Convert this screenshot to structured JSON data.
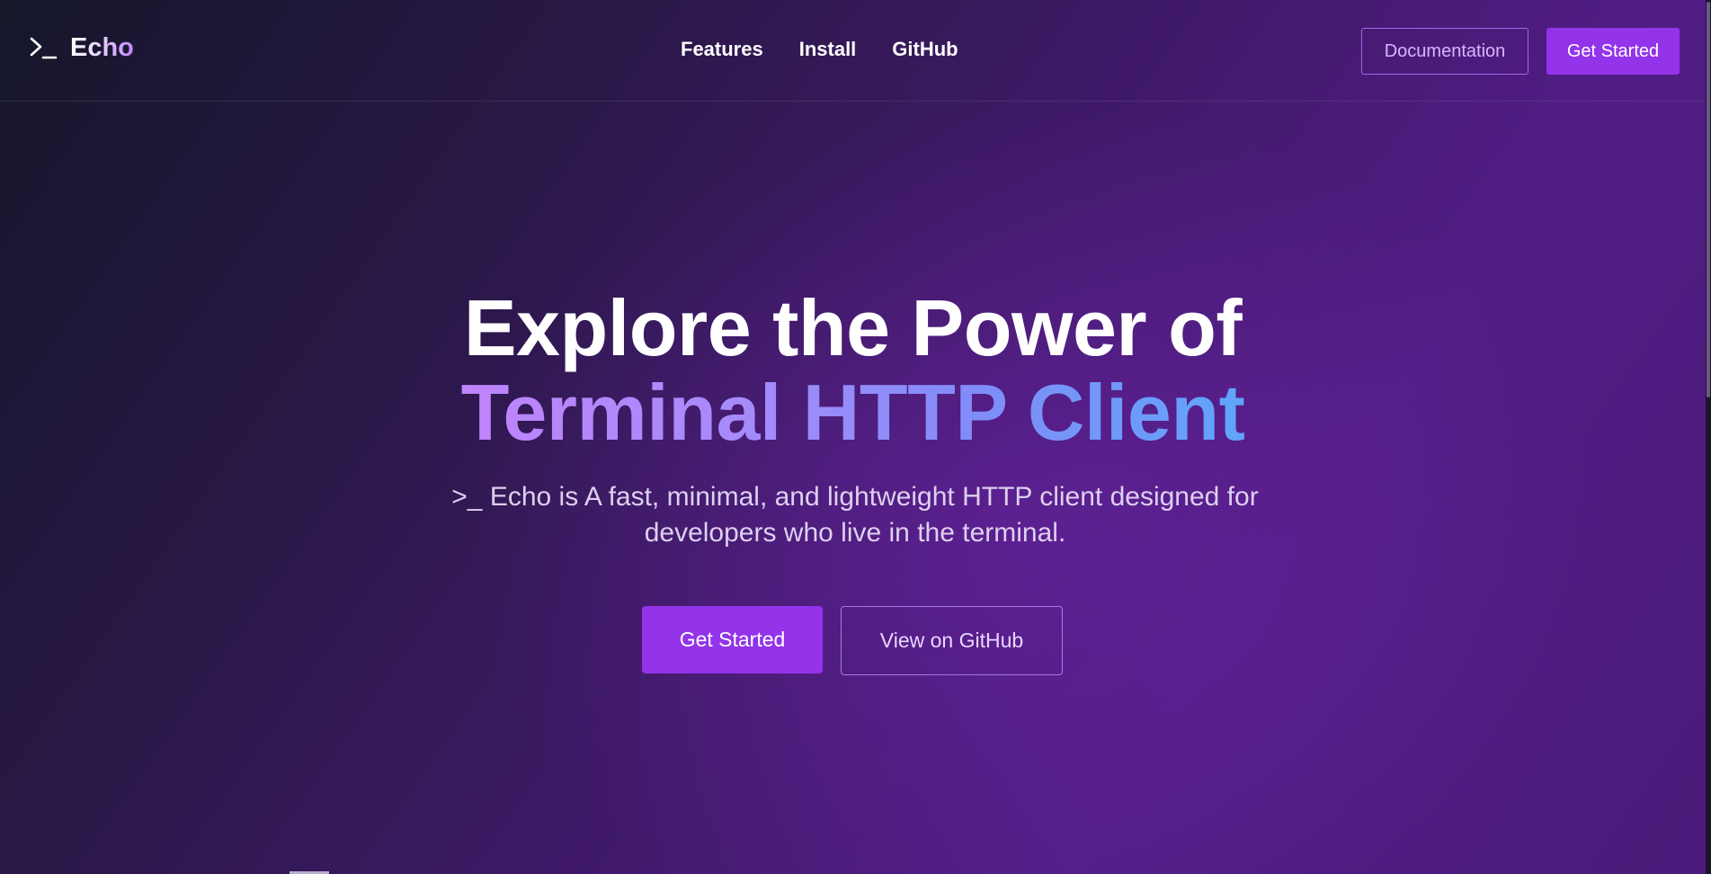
{
  "brand": {
    "icon": "terminal-prompt-icon",
    "name": "Echo"
  },
  "nav": {
    "links": [
      "Features",
      "Install",
      "GitHub"
    ],
    "documentation_label": "Documentation",
    "get_started_label": "Get Started"
  },
  "hero": {
    "title_line1": "Explore the Power of",
    "title_line2": "Terminal HTTP Client",
    "subtitle_line1": ">_ Echo is A fast, minimal, and lightweight HTTP client designed for",
    "subtitle_line2": "developers who live in the terminal.",
    "primary_button": "Get Started",
    "secondary_button": "View on GitHub"
  },
  "colors": {
    "accent": "#9333ea",
    "outline": "#9f67e6",
    "gradient_start": "#c084fc",
    "gradient_end": "#60a5fa"
  }
}
